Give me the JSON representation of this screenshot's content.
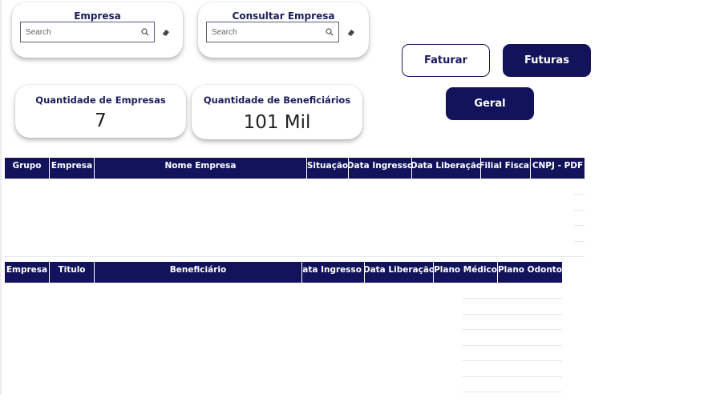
{
  "slicers": [
    {
      "title": "Empresa",
      "search_placeholder": "Search",
      "search_icon": "magnifier",
      "clear_icon": "eraser"
    },
    {
      "title": "Consultar Empresa",
      "search_placeholder": "Search",
      "search_icon": "magnifier",
      "clear_icon": "eraser"
    }
  ],
  "kpis": [
    {
      "title": "Quantidade de Empresas",
      "value": "7"
    },
    {
      "title": "Quantidade de Beneficiários",
      "value": "101 Mil"
    }
  ],
  "buttons": {
    "faturar": "Faturar",
    "futuras": "Futuras",
    "geral": "Geral"
  },
  "companies_table": {
    "columns": [
      "Grupo",
      "Empresa",
      "Nome Empresa",
      "Situação",
      "Data Ingresso",
      "Data Liberação",
      "Filial Fiscal",
      "CNPJ - PDF"
    ],
    "rows": []
  },
  "beneficiaries_table": {
    "columns": [
      "Empresa",
      "Titulo",
      "Beneficiário",
      "Data Ingresso",
      "Data Liberação",
      "Plano Médico",
      "Plano Odonto"
    ],
    "rows": []
  },
  "colors": {
    "navy": "#13135c",
    "title_text": "#1d1d5c",
    "background": "#ffffff"
  }
}
